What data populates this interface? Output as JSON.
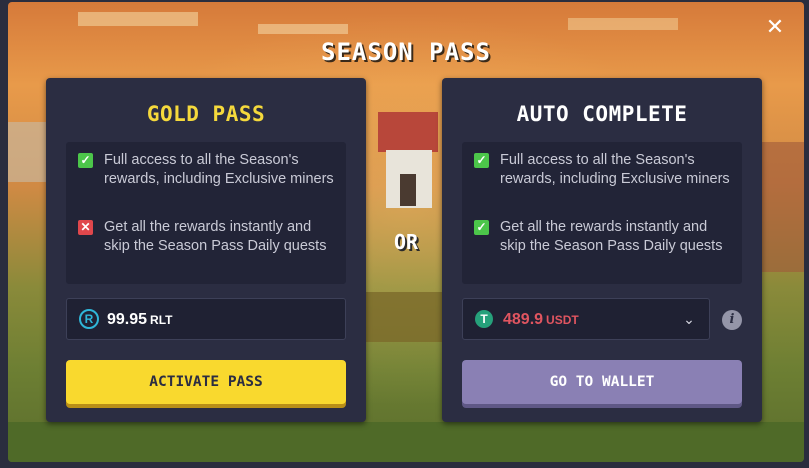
{
  "modal": {
    "title": "SEASON PASS",
    "close_icon": "close-icon",
    "divider_text": "OR"
  },
  "gold_pass": {
    "title": "GOLD PASS",
    "features": [
      {
        "text": "Full access to all the Season's rewards, including Exclusive miners",
        "status": "included",
        "icon": "check-icon"
      },
      {
        "text": "Get all the rewards instantly and skip the Season Pass Daily quests",
        "status": "excluded",
        "icon": "cross-icon"
      }
    ],
    "price": {
      "amount": "99.95",
      "currency": "RLT",
      "coin_icon": "rlt-coin-icon",
      "coin_glyph": "R"
    },
    "button_label": "ACTIVATE PASS"
  },
  "auto_complete": {
    "title": "AUTO COMPLETE",
    "features": [
      {
        "text": "Full access to all the Season's rewards, including Exclusive miners",
        "status": "included",
        "icon": "check-icon"
      },
      {
        "text": "Get all the rewards instantly and skip the Season Pass Daily quests",
        "status": "included",
        "icon": "check-icon"
      }
    ],
    "price": {
      "amount": "489.9",
      "currency": "USDT",
      "coin_icon": "usdt-coin-icon",
      "coin_glyph": "T"
    },
    "info_icon": "info-icon",
    "info_glyph": "i",
    "button_label": "GO TO WALLET"
  },
  "colors": {
    "gold_accent": "#f9d92e",
    "wallet_button": "#8a80b4",
    "check_green": "#4cc64a",
    "cross_red": "#e0474c",
    "usdt_price_red": "#e05560",
    "card_background": "#2b2d42"
  }
}
